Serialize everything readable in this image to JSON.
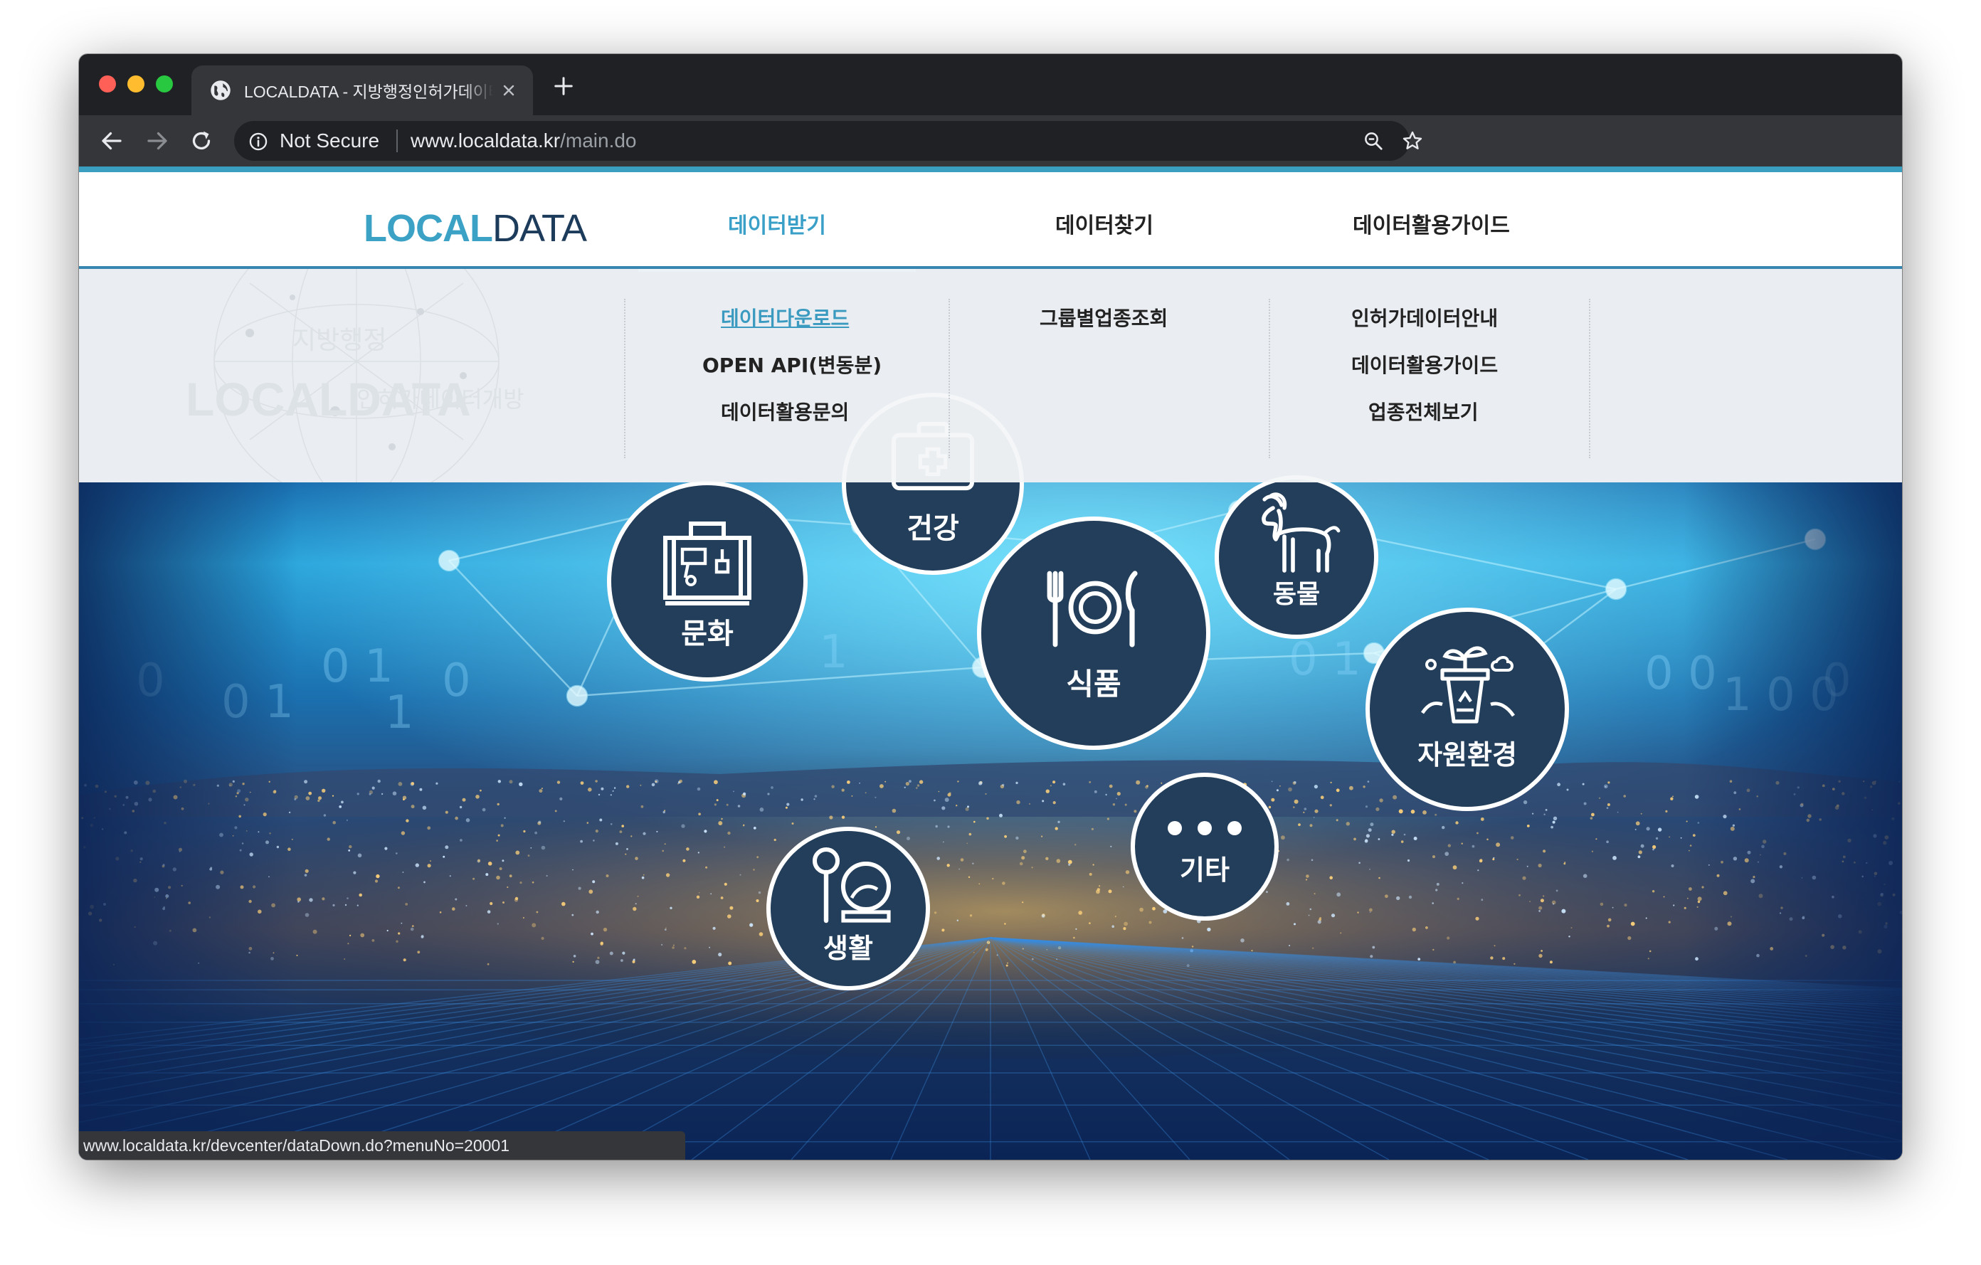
{
  "browser": {
    "tab_title": "LOCALDATA - 지방행정인허가데이터",
    "security_label": "Not Secure",
    "url_host": "www.localdata.kr",
    "url_path": "/main.do",
    "status_url": "www.localdata.kr/devcenter/dataDown.do?menuNo=20001"
  },
  "logo": {
    "part1": "LOCAL",
    "part2": "DATA"
  },
  "gnb": [
    {
      "label": "데이터받기",
      "active": true
    },
    {
      "label": "데이터찾기",
      "active": false
    },
    {
      "label": "데이터활용가이드",
      "active": false
    }
  ],
  "submenu": {
    "col1": [
      "데이터다운로드",
      "OPEN API(변동분)",
      "데이터활용문의"
    ],
    "col2": [
      "그룹별업종조회"
    ],
    "col3": [
      "인허가데이터안내",
      "데이터활용가이드",
      "업종전체보기"
    ]
  },
  "watermark": {
    "logo": "LOCALDATA",
    "line1": "지방행정",
    "line2": "인허가데이터개방"
  },
  "categories": [
    {
      "label": "건강",
      "icon": "first-aid-kit-icon"
    },
    {
      "label": "동물",
      "icon": "goat-icon"
    },
    {
      "label": "문화",
      "icon": "suitcase-icon"
    },
    {
      "label": "식품",
      "icon": "plate-cutlery-icon"
    },
    {
      "label": "자원환경",
      "icon": "recycle-plant-icon"
    },
    {
      "label": "생활",
      "icon": "mirror-brush-icon"
    },
    {
      "label": "기타",
      "icon": "more-dots-icon"
    }
  ],
  "colors": {
    "accent": "#3aa0c7",
    "circle": "#233e5a",
    "browser_dark": "#202124"
  }
}
